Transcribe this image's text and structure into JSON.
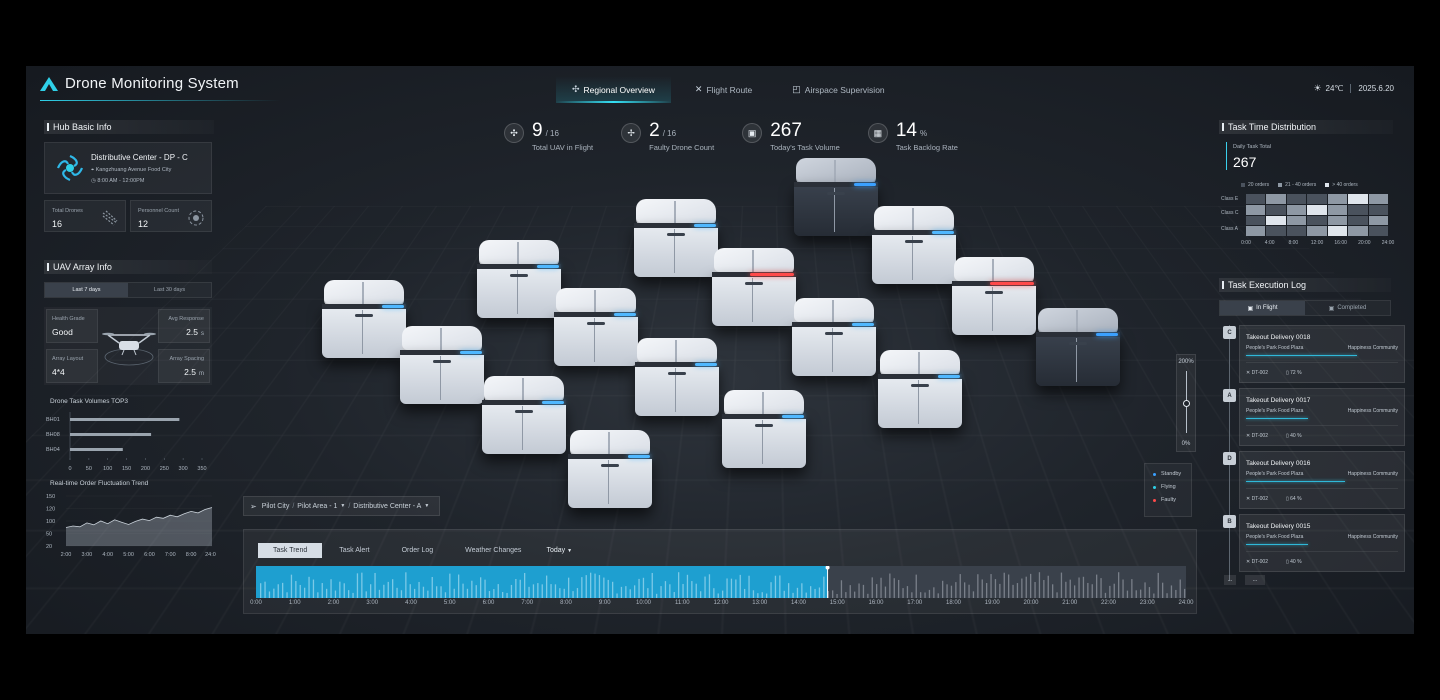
{
  "header": {
    "title": "Drone Monitoring System",
    "nav": [
      {
        "label": "Regional Overview",
        "icon": "drone-icon",
        "active": true
      },
      {
        "label": "Flight Route",
        "icon": "route-icon",
        "active": false
      },
      {
        "label": "Airspace Supervision",
        "icon": "airspace-icon",
        "active": false
      }
    ],
    "temperature": "24℃",
    "date": "2025.6.20",
    "accent": "#2fd0e8"
  },
  "stats": [
    {
      "value": "9",
      "unit": "/ 16",
      "label": "Total UAV in Flight",
      "icon": "drone-icon"
    },
    {
      "value": "2",
      "unit": "/ 16",
      "label": "Faulty Drone Count",
      "icon": "fan-icon"
    },
    {
      "value": "267",
      "unit": "",
      "label": "Today's Task Volume",
      "icon": "package-icon"
    },
    {
      "value": "14",
      "unit": "%",
      "label": "Task Backlog Rate",
      "icon": "boxes-icon"
    }
  ],
  "hub": {
    "title": "Hub Basic Info",
    "name": "Distributive Center - DP - C",
    "address": "Kangzhuang Avenue Food City",
    "hours": "8:00 AM - 12:00PM",
    "total_drones_label": "Total Drones",
    "total_drones": "16",
    "personnel_label": "Personnel Count",
    "personnel": "12"
  },
  "uav": {
    "title": "UAV Array Info",
    "ranges": [
      "Last 7 days",
      "Last 30 days"
    ],
    "active_range": 0,
    "health_label": "Health Grade",
    "health": "Good",
    "avg_response_label": "Avg Response",
    "avg_response": "2.5",
    "avg_response_unit": "s",
    "layout_label": "Array Layout",
    "layout": "4*4",
    "spacing_label": "Array Spacing",
    "spacing": "2.5",
    "spacing_unit": "m"
  },
  "top3": {
    "title": "Drone Task Volumes TOP3",
    "categories": [
      "BH01",
      "BH08",
      "BH04"
    ],
    "values": [
      290,
      215,
      140
    ],
    "ticks": [
      "0",
      "50",
      "100",
      "150",
      "200",
      "250",
      "300",
      "350"
    ],
    "max": 350
  },
  "trend": {
    "title": "Real-time Order Fluctuation Trend",
    "y_ticks": [
      "150",
      "120",
      "100",
      "50",
      "20"
    ],
    "x_ticks": [
      "2:00",
      "3:00",
      "4:00",
      "5:00",
      "6:00",
      "7:00",
      "8:00",
      "24:00"
    ],
    "values": [
      68,
      72,
      70,
      80,
      75,
      85,
      78,
      88,
      82,
      76,
      84,
      90,
      86,
      95,
      92,
      100,
      96,
      104,
      110,
      106,
      115,
      120
    ]
  },
  "task_time": {
    "title": "Task Time Distribution",
    "daily_label": "Daily Task Total",
    "daily_value": "267",
    "legend": [
      "20 orders",
      "21 - 40 orders",
      "> 40 orders"
    ],
    "rows": [
      "Class E",
      "Class C",
      "Class A"
    ],
    "x_ticks": [
      "0:00",
      "4:00",
      "8:00",
      "12:00",
      "16:00",
      "20:00",
      "24:00"
    ],
    "cells": [
      1,
      2,
      1,
      1,
      2,
      3,
      2,
      2,
      1,
      2,
      3,
      2,
      1,
      1,
      1,
      3,
      2,
      1,
      2,
      1,
      2,
      2,
      1,
      1,
      2,
      3,
      2,
      1
    ]
  },
  "log": {
    "title": "Task Execution Log",
    "tabs": [
      "In Flight",
      "Completed"
    ],
    "active_tab": 0,
    "nodes": [
      "C",
      "A",
      "D",
      "B",
      "..."
    ],
    "more": "...",
    "tasks": [
      {
        "title": "Takeout Delivery 0018",
        "from": "People's Park Food Plaza",
        "to": "Happiness Community",
        "id": "DT-002",
        "pct": "72 %",
        "progress": 0.72
      },
      {
        "title": "Takeout Delivery 0017",
        "from": "People's Park Food Plaza",
        "to": "Happiness Community",
        "id": "DT-002",
        "pct": "40 %",
        "progress": 0.4
      },
      {
        "title": "Takeout Delivery 0016",
        "from": "People's Park Food Plaza",
        "to": "Happiness Community",
        "id": "DT-002",
        "pct": "64 %",
        "progress": 0.64
      },
      {
        "title": "Takeout Delivery 0015",
        "from": "People's Park Food Plaza",
        "to": "Happiness Community",
        "id": "DT-002",
        "pct": "40 %",
        "progress": 0.4
      }
    ]
  },
  "zoom": {
    "max": "200%",
    "min": "0%",
    "level": 0.35
  },
  "legend": [
    {
      "label": "Standby",
      "color": "#3aa0ff"
    },
    {
      "label": "Flying",
      "color": "#2fd0e8"
    },
    {
      "label": "Faulty",
      "color": "#ff4a4a"
    }
  ],
  "breadcrumb": [
    "Pilot City",
    "Pilot Area - 1",
    "Distributive Center - A"
  ],
  "bottom": {
    "tabs": [
      "Task Trend",
      "Task Alert",
      "Order Log",
      "Weather Changes"
    ],
    "active_tab": 0,
    "range": "Today",
    "time_ticks": [
      "0:00",
      "1:00",
      "2:00",
      "3:00",
      "4:00",
      "5:00",
      "6:00",
      "7:00",
      "8:00",
      "9:00",
      "10:00",
      "11:00",
      "12:00",
      "13:00",
      "14:00",
      "15:00",
      "16:00",
      "17:00",
      "18:00",
      "19:00",
      "20:00",
      "21:00",
      "22:00",
      "23:00",
      "24:00"
    ],
    "current_hour": 14.75,
    "bar_color": "#1e9fd0"
  }
}
